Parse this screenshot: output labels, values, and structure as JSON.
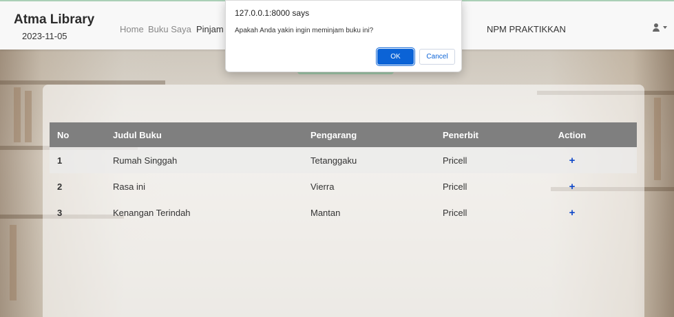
{
  "navbar": {
    "brand": "Atma Library",
    "date": "2023-11-05",
    "links": [
      "Home",
      "Buku Saya",
      "Pinjam"
    ],
    "npm": "NPM PRAKTIKKAN"
  },
  "dialog": {
    "title": "127.0.0.1:8000 says",
    "message": "Apakah Anda yakin ingin meminjam buku ini?",
    "ok_label": "OK",
    "cancel_label": "Cancel"
  },
  "table": {
    "headers": [
      "No",
      "Judul Buku",
      "Pengarang",
      "Penerbit",
      "Action"
    ],
    "rows": [
      {
        "no": "1",
        "judul": "Rumah Singgah",
        "pengarang": "Tetanggaku",
        "penerbit": "Pricell",
        "action": "+"
      },
      {
        "no": "2",
        "judul": "Rasa ini",
        "pengarang": "Vierra",
        "penerbit": "Pricell",
        "action": "+"
      },
      {
        "no": "3",
        "judul": "Kenangan Terindah",
        "pengarang": "Mantan",
        "penerbit": "Pricell",
        "action": "+"
      }
    ]
  },
  "icons": {
    "user": "user-icon",
    "caret": "caret-down-icon",
    "add": "plus-icon"
  },
  "colors": {
    "accent": "#0b63d6",
    "header_bg": "#7f7f7f"
  }
}
